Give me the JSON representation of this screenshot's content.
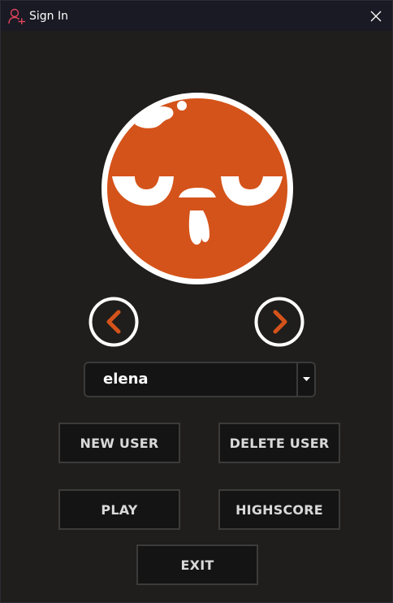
{
  "window": {
    "title": "Sign In",
    "title_icon": "add-user-icon",
    "close_icon": "close-icon"
  },
  "avatar": {
    "icon": "orange-bird-face-avatar",
    "color": "#d4531a"
  },
  "navigation": {
    "prev_icon": "chevron-left-icon",
    "next_icon": "chevron-right-icon",
    "accent_color": "#d4531a"
  },
  "user_select": {
    "value": "elena",
    "arrow_icon": "caret-down-icon"
  },
  "buttons": {
    "new_user": "NEW USER",
    "delete_user": "DELETE USER",
    "play": "PLAY",
    "highscore": "HIGHSCORE",
    "exit": "EXIT"
  },
  "colors": {
    "background": "#1f1e1c",
    "titlebar": "#1a1a24",
    "button_bg": "#141414",
    "button_border": "#3c3b3a",
    "button_text": "#d9d9d9",
    "title_icon": "#e0435a"
  }
}
